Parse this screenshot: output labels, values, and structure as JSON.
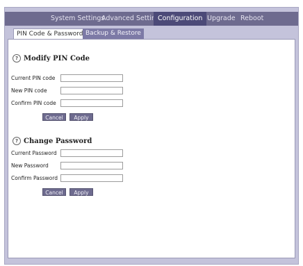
{
  "topnav": {
    "items": [
      {
        "label": "System Settings"
      },
      {
        "label": "Advanced Settings"
      },
      {
        "label": "Configuration"
      },
      {
        "label": "Upgrade"
      },
      {
        "label": "Reboot"
      }
    ],
    "active": "Configuration"
  },
  "tabs": [
    {
      "label": "PIN Code & Password",
      "active": true
    },
    {
      "label": "Backup & Restore",
      "active": false
    }
  ],
  "pin_section": {
    "help_icon": "?",
    "title": "Modify PIN Code",
    "fields": [
      {
        "label": "Current PIN code",
        "value": ""
      },
      {
        "label": "New PIN code",
        "value": ""
      },
      {
        "label": "Confirm PIN code",
        "value": ""
      }
    ],
    "cancel_label": "Cancel",
    "apply_label": "Apply"
  },
  "password_section": {
    "help_icon": "?",
    "title": "Change Password",
    "fields": [
      {
        "label": "Current Password",
        "value": ""
      },
      {
        "label": "New Password",
        "value": ""
      },
      {
        "label": "Confirm Password",
        "value": ""
      }
    ],
    "cancel_label": "Cancel",
    "apply_label": "Apply"
  },
  "colors": {
    "nav_bg": "#6e6b8f",
    "nav_active": "#4c4a78",
    "frame_bg": "#c4c3db",
    "button_bg": "#6e6b8f"
  }
}
